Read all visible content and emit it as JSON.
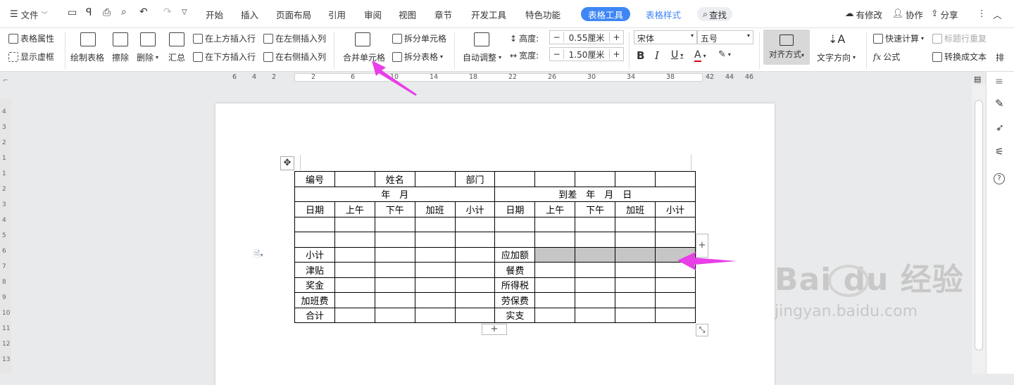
{
  "menubar": {
    "file_label": "文件",
    "tabs": [
      "开始",
      "插入",
      "页面布局",
      "引用",
      "审阅",
      "视图",
      "章节",
      "开发工具",
      "特色功能"
    ],
    "active_tab": "表格工具",
    "tab_style": "表格样式",
    "search_label": "查找",
    "right": {
      "modified": "有修改",
      "collab": "协作",
      "share": "分享"
    }
  },
  "ribbon": {
    "table_props": "表格属性",
    "show_grid": "显示虚框",
    "draw_table": "绘制表格",
    "erase": "擦除",
    "delete": "删除",
    "summary": "汇总",
    "insert_above": "在上方插入行",
    "insert_below": "在下方插入行",
    "insert_left": "在左侧插入列",
    "insert_right": "在右侧插入列",
    "merge_cells": "合并单元格",
    "split_cells": "拆分单元格",
    "split_table": "拆分表格",
    "auto_adjust": "自动调整",
    "height_label": "高度:",
    "height_value": "0.55厘米",
    "width_label": "宽度:",
    "width_value": "1.50厘米",
    "font_name": "宋体",
    "font_size": "五号",
    "align": "对齐方式",
    "text_dir": "文字方向",
    "quick_calc": "快速计算",
    "title_repeat": "标题行重复",
    "formula": "公式",
    "to_text": "转换成文本",
    "more": "排"
  },
  "ruler": {
    "numbers": [
      "6",
      "4",
      "2",
      "2",
      "6",
      "10",
      "14",
      "18",
      "22",
      "26",
      "30",
      "34",
      "38",
      "42",
      "44",
      "46"
    ]
  },
  "vruler": {
    "numbers": [
      "4",
      "3",
      "2",
      "1",
      "1",
      "2",
      "3",
      "4",
      "5",
      "6",
      "7",
      "8",
      "9",
      "10",
      "11",
      "12",
      "13"
    ]
  },
  "table": {
    "rows": [
      [
        "编号",
        "",
        "姓名",
        "",
        "部门",
        "",
        "",
        "",
        "",
        ""
      ],
      [
        "年　月",
        "到差　年　月　日"
      ],
      [
        "日期",
        "上午",
        "下午",
        "加班",
        "小计",
        "日期",
        "上午",
        "下午",
        "加班",
        "小计"
      ],
      [
        "",
        "",
        "",
        "",
        "",
        "",
        "",
        "",
        "",
        ""
      ],
      [
        "",
        "",
        "",
        "",
        "",
        "",
        "",
        "",
        "",
        ""
      ],
      [
        "小计",
        "",
        "",
        "",
        "",
        "应加额",
        "",
        "",
        "",
        ""
      ],
      [
        "津贴",
        "",
        "",
        "",
        "",
        "餐费",
        "",
        "",
        "",
        ""
      ],
      [
        "奖金",
        "",
        "",
        "",
        "",
        "所得税",
        "",
        "",
        "",
        ""
      ],
      [
        "加班费",
        "",
        "",
        "",
        "",
        "劳保费",
        "",
        "",
        "",
        ""
      ],
      [
        "合计",
        "",
        "",
        "",
        "",
        "实支",
        "",
        "",
        "",
        ""
      ]
    ]
  },
  "add_row_symbol": "+",
  "add_col_symbol": "+",
  "watermark": {
    "brand": "Bai du 经验",
    "url": "jingyan.baidu.com"
  },
  "colors": {
    "accent": "#3f86f4",
    "arrow": "#e83fe8",
    "selection": "#c6c6c6"
  }
}
